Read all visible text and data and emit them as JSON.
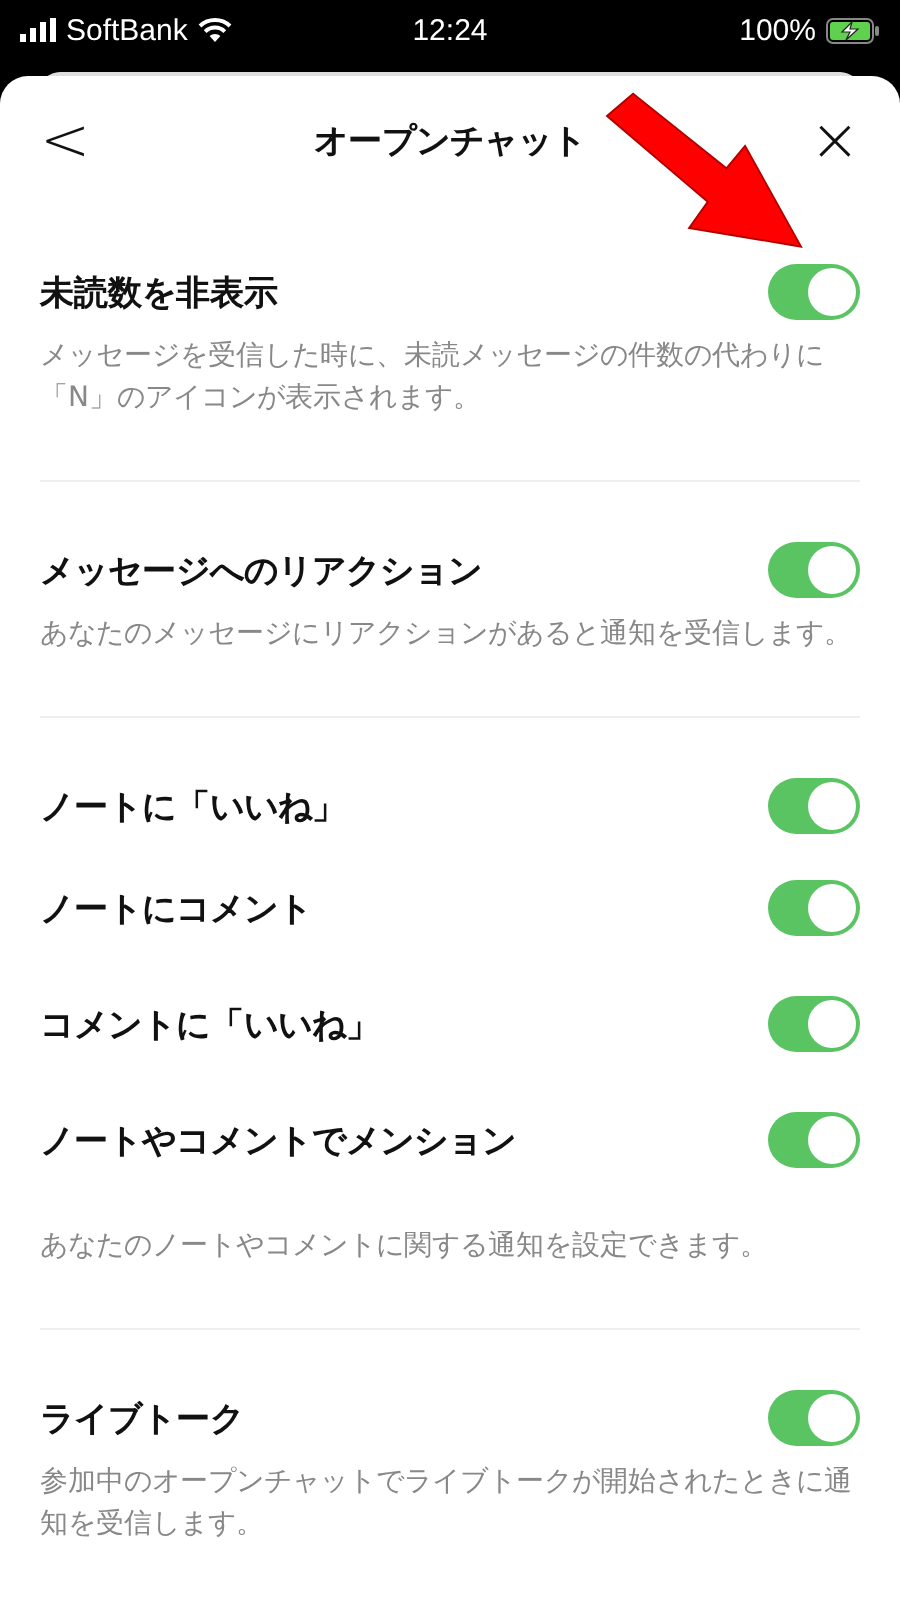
{
  "status_bar": {
    "carrier": "SoftBank",
    "time": "12:24",
    "battery": "100%"
  },
  "header": {
    "back": "<",
    "title": "オープンチャット",
    "close": "×"
  },
  "sections": [
    {
      "items": [
        {
          "label": "未読数を非表示",
          "on": true
        }
      ],
      "description": "メッセージを受信した時に、未読メッセージの件数の代わりに「N」のアイコンが表示されます。"
    },
    {
      "items": [
        {
          "label": "メッセージへのリアクション",
          "on": true
        }
      ],
      "description": "あなたのメッセージにリアクションがあると通知を受信します。"
    },
    {
      "items": [
        {
          "label": "ノートに「いいね」",
          "on": true
        },
        {
          "label": "ノートにコメント",
          "on": true
        },
        {
          "label": "コメントに「いいね」",
          "on": true
        },
        {
          "label": "ノートやコメントでメンション",
          "on": true
        }
      ],
      "description": "あなたのノートやコメントに関する通知を設定できます。"
    },
    {
      "items": [
        {
          "label": "ライブトーク",
          "on": true
        }
      ],
      "description": "参加中のオープンチャットでライブトークが開始されたときに通知を受信します。"
    }
  ]
}
